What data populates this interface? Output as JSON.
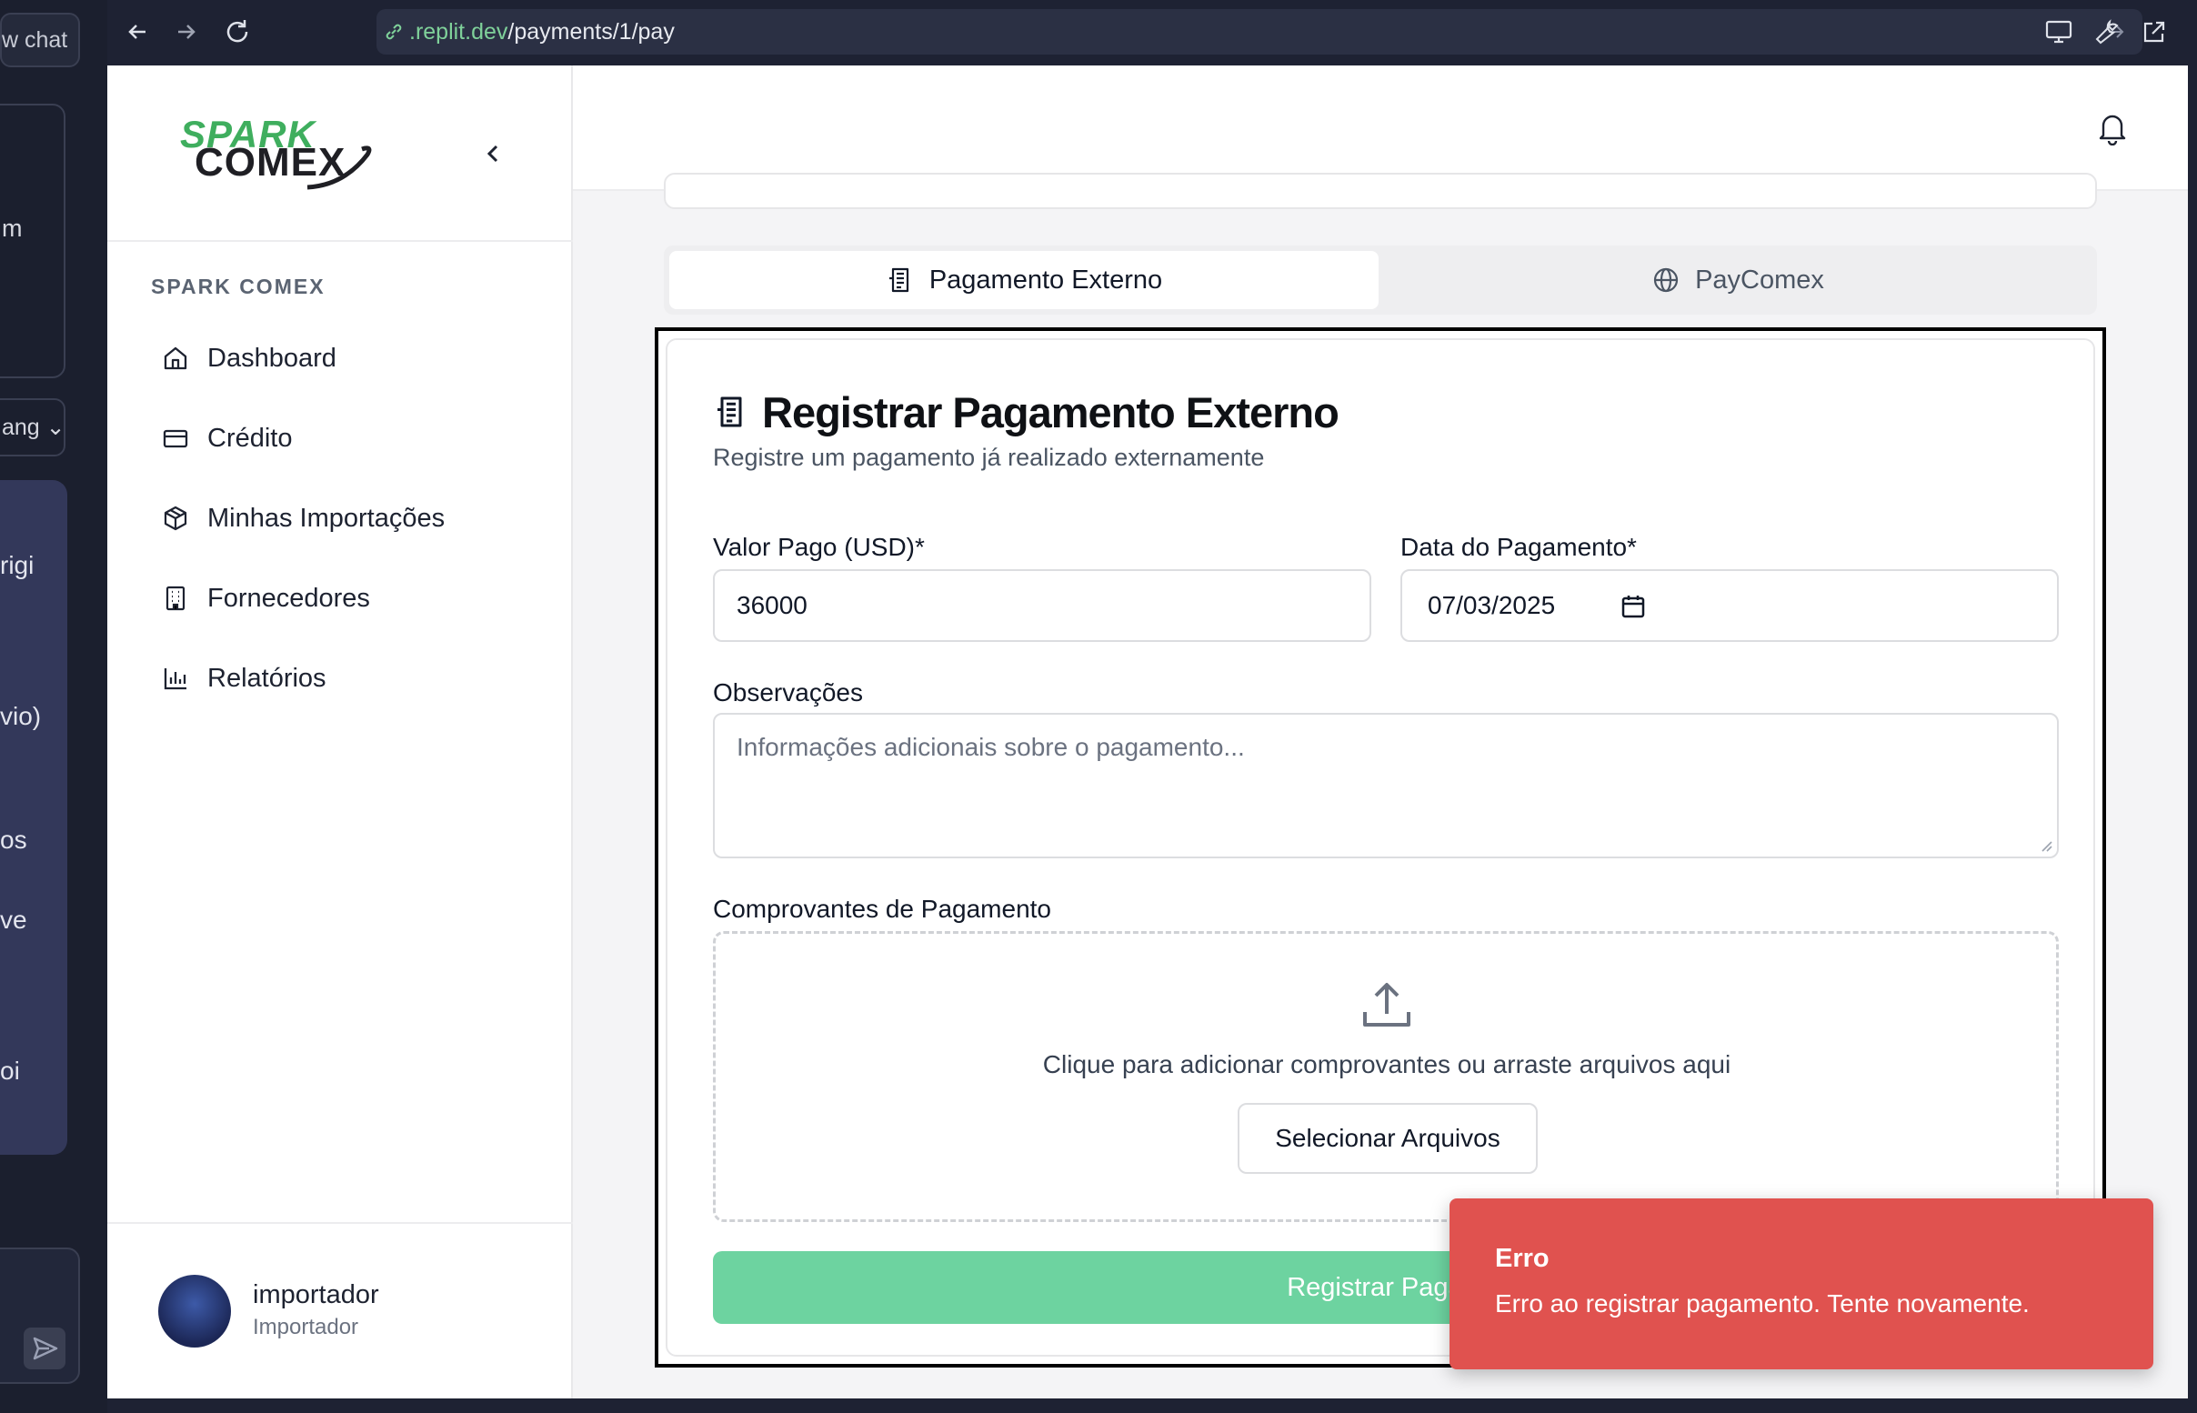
{
  "chat_panel": {
    "new_chat": "w chat",
    "card_fragment": "m",
    "select_fragment": "ang",
    "fragments": [
      "rigi",
      "vio)",
      "os",
      "ve",
      "oi"
    ]
  },
  "browser": {
    "url_domain": ".replit.dev",
    "url_path": "/payments/1/pay"
  },
  "logo": {
    "line1": "SPARK",
    "line2": "COMEX"
  },
  "sidebar": {
    "section": "SPARK COMEX",
    "items": [
      {
        "label": "Dashboard",
        "icon": "home-icon"
      },
      {
        "label": "Crédito",
        "icon": "credit-card-icon"
      },
      {
        "label": "Minhas Importações",
        "icon": "package-icon"
      },
      {
        "label": "Fornecedores",
        "icon": "building-icon"
      },
      {
        "label": "Relatórios",
        "icon": "bar-chart-icon"
      }
    ],
    "user": {
      "name": "importador",
      "role": "Importador"
    }
  },
  "tabs": [
    {
      "label": "Pagamento Externo",
      "icon": "receipt-icon",
      "active": true
    },
    {
      "label": "PayComex",
      "icon": "globe-icon",
      "active": false
    }
  ],
  "form": {
    "title": "Registrar Pagamento Externo",
    "subtitle": "Registre um pagamento já realizado externamente",
    "amount_label": "Valor Pago (USD)*",
    "amount_value": "36000",
    "date_label": "Data do Pagamento*",
    "date_value": "07/03/2025",
    "notes_label": "Observações",
    "notes_placeholder": "Informações adicionais sobre o pagamento...",
    "receipts_label": "Comprovantes de Pagamento",
    "drop_text": "Clique para adicionar comprovantes ou arraste arquivos aqui",
    "select_files": "Selecionar Arquivos",
    "submit": "Registrar Pagam"
  },
  "toast": {
    "title": "Erro",
    "message": "Erro ao registrar pagamento. Tente novamente.",
    "color": "#e0524f"
  },
  "colors": {
    "brand_green": "#3fae5e",
    "submit_green": "#6dd3a0"
  }
}
